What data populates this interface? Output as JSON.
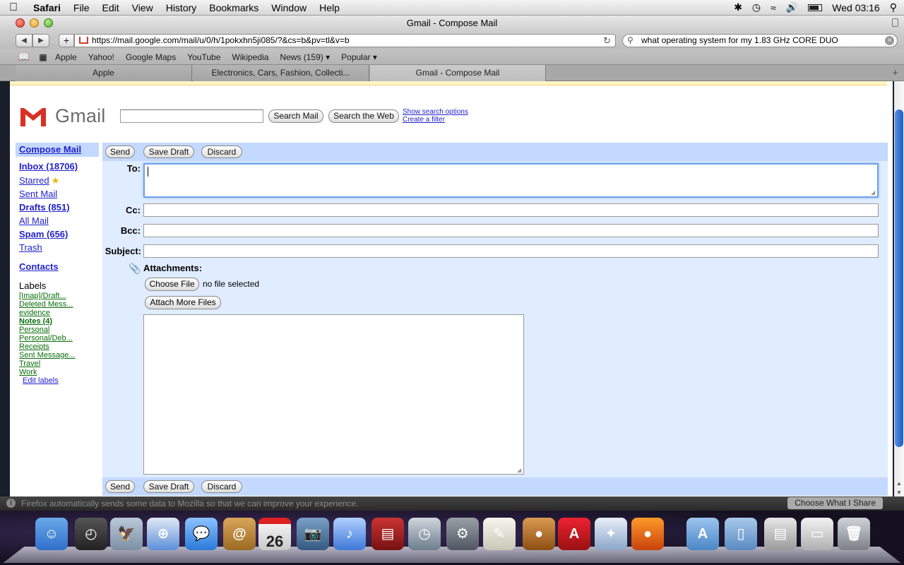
{
  "menubar": {
    "app": "Safari",
    "items": [
      "File",
      "Edit",
      "View",
      "History",
      "Bookmarks",
      "Window",
      "Help"
    ],
    "clock": "Wed 03:16"
  },
  "window": {
    "title": "Gmail - Compose Mail"
  },
  "toolbar": {
    "url": "https://mail.google.com/mail/u/0/h/1pokxhn5ji085/?&cs=b&pv=tl&v=b",
    "search_query": "what operating system for my 1.83 GHz CORE DUO"
  },
  "bookmarks": [
    "Apple",
    "Yahoo!",
    "Google Maps",
    "YouTube",
    "Wikipedia",
    "News (159) ▾",
    "Popular ▾"
  ],
  "tabs": [
    "Apple",
    "Electronics, Cars, Fashion, Collecti...",
    "Gmail - Compose Mail"
  ],
  "gmail": {
    "logo_text": "Gmail",
    "search_mail_label": "Search Mail",
    "search_web_label": "Search the Web",
    "show_search_options": "Show search options",
    "create_filter": "Create a filter"
  },
  "nav": {
    "compose": "Compose Mail",
    "inbox": "Inbox (18706)",
    "starred": "Starred",
    "sent": "Sent Mail",
    "drafts": "Drafts (851)",
    "all": "All Mail",
    "spam": "Spam (656)",
    "trash": "Trash",
    "contacts": "Contacts",
    "labels_title": "Labels",
    "labels": [
      "[Imap]/Draft...",
      "Deleted Mess...",
      "evidence",
      "Notes (4)",
      "Personal",
      "Personal/Deb...",
      "Receipts",
      "Sent Message...",
      "Travel",
      "Work"
    ],
    "edit_labels": "Edit labels"
  },
  "compose": {
    "send": "Send",
    "save_draft": "Save Draft",
    "discard": "Discard",
    "to_label": "To:",
    "cc_label": "Cc:",
    "bcc_label": "Bcc:",
    "subject_label": "Subject:",
    "attachments_label": "Attachments:",
    "choose_file": "Choose File",
    "no_file": "no file selected",
    "attach_more": "Attach More Files"
  },
  "firefox_bar": {
    "message": "Firefox automatically sends some data to Mozilla so that we can improve your experience.",
    "button": "Choose What I Share"
  },
  "dock": {
    "calendar_day": "26",
    "items": [
      "finder-icon",
      "dashboard-icon",
      "mail-eagle-icon",
      "safari-icon",
      "ichat-icon",
      "address-book-icon",
      "ical-icon",
      "iphoto-icon",
      "itunes-icon",
      "front-row-icon",
      "time-machine-icon",
      "system-preferences-icon",
      "textedit-icon",
      "app-icon",
      "acrobat-icon",
      "network-icon",
      "firefox-icon",
      "applications-folder-icon",
      "documents-folder-icon",
      "downloads-stack-icon",
      "screenshot-stack-icon",
      "trash-icon"
    ]
  }
}
